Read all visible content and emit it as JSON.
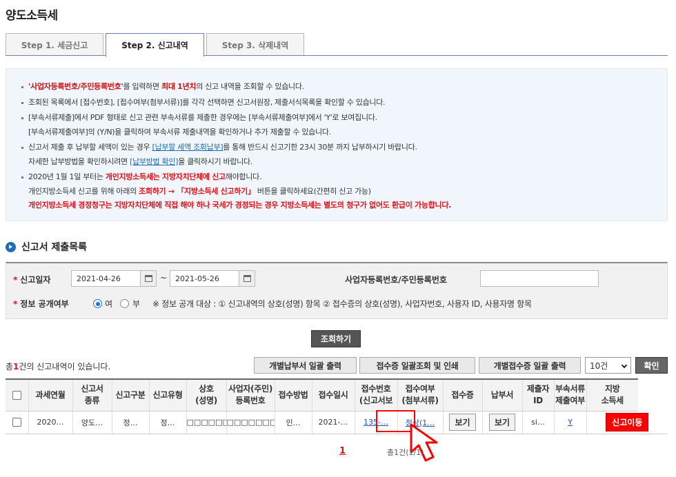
{
  "page_title": "양도소득세",
  "tabs": [
    "Step 1. 세금신고",
    "Step 2. 신고내역",
    "Step 3. 삭제내역"
  ],
  "info": {
    "l1_a": "'사업자등록번호/주민등록번호'",
    "l1_b": "를 입력하면 ",
    "l1_c": "최대 1년치",
    "l1_d": "의 신고 내역을 조회할 수 있습니다.",
    "l2": "조회된 목록에서 [접수번호], [접수여부(첨부서류)]를 각각 선택하면 신고서원장, 제출서식목록을 확인할 수 있습니다.",
    "l3": "[부속서류제출]에서 PDF 형태로 신고 관련 부속서류를 제출한 경우에는 [부속서류제출여부]에서 'Y'로 보여집니다.",
    "l4": "[부속서류제출여부]의 (Y/N)을 클릭하여 부속서류 제출내역을 확인하거나 추가 제출할 수 있습니다.",
    "l5_a": "신고서 제출 후 납부할 세액이 있는 경우 ",
    "l5_link": "[납부할 세액 조회납부]",
    "l5_b": "를 통해 반드시 신고기한 23시 30분 까지 납부하시기 바랍니다.",
    "l6_a": "자세한 납부방법을 확인하시려면 ",
    "l6_link": "[납부방법 확인]",
    "l6_b": "을 클릭하시기 바랍니다.",
    "l7_a": "2020년 1월 1일 부터는 ",
    "l7_b": "개인지방소득세는 지방자치단체에 신고",
    "l7_c": "해야합니다.",
    "l8_a": "개인지방소득세 신고를 위해 아래의 ",
    "l8_b": "조회하기 → 「지방소득세 신고하기」",
    "l8_c": " 버튼을 클릭하세요(간편히 신고 가능)",
    "l9": "개인지방소득세 경정청구는 지방자치단체에 직접 해야 하나 국세가 경정되는 경우 지방소득세는 별도의 청구가 없어도 환급이 가능합니다."
  },
  "section_title": "신고서 제출목록",
  "search": {
    "date_label": "신고일자",
    "date_from": "2021-04-26",
    "tilde": "~",
    "date_to": "2021-05-26",
    "id_label": "사업자등록번호/주민등록번호",
    "disclose_label": "정보 공개여부",
    "yes": "여",
    "no": "부",
    "disclose_note": "※ 정보 공개 대상 : ① 신고내역의 상호(성명) 항목 ② 접수증의 상호(성명), 사업자번호, 사용자 ID, 사용자명 항목"
  },
  "buttons": {
    "search": "조회하기",
    "bulk_pay": "개별납부서 일괄 출력",
    "bulk_receipt": "접수증 일괄조회 및 인쇄",
    "bulk_individual": "개별접수증 일괄 출력",
    "page_size": "10건",
    "confirm": "확인"
  },
  "count": {
    "prefix": "총",
    "num": "1",
    "suffix": "건의 신고내역이 있습니다."
  },
  "columns": [
    "과세연월",
    "신고서\n종류",
    "신고구분",
    "신고유형",
    "상호\n(성명)",
    "사업자(주민)\n등록번호",
    "접수방법",
    "접수일시",
    "접수번호\n(신고서보",
    "접수여부\n(첨부서류)",
    "접수증",
    "납부서",
    "제출자\nID",
    "부속서류\n제출여부",
    "지방\n소득세"
  ],
  "row": {
    "period": "2020…",
    "kind": "양도…",
    "div": "정…",
    "type": "정…",
    "name": "□□□□□□□",
    "regno": "□□□□□□□",
    "method": "인…",
    "datetime": "2021-…",
    "receipt_no": "135-…",
    "status": "정상(1…",
    "receipt_btn": "보기",
    "pay_btn": "보기",
    "submitter": "si…",
    "attach": "Y",
    "local_tax_btn": "신고이동"
  },
  "pager": {
    "page": "1",
    "info": "총1건(1/1)"
  }
}
